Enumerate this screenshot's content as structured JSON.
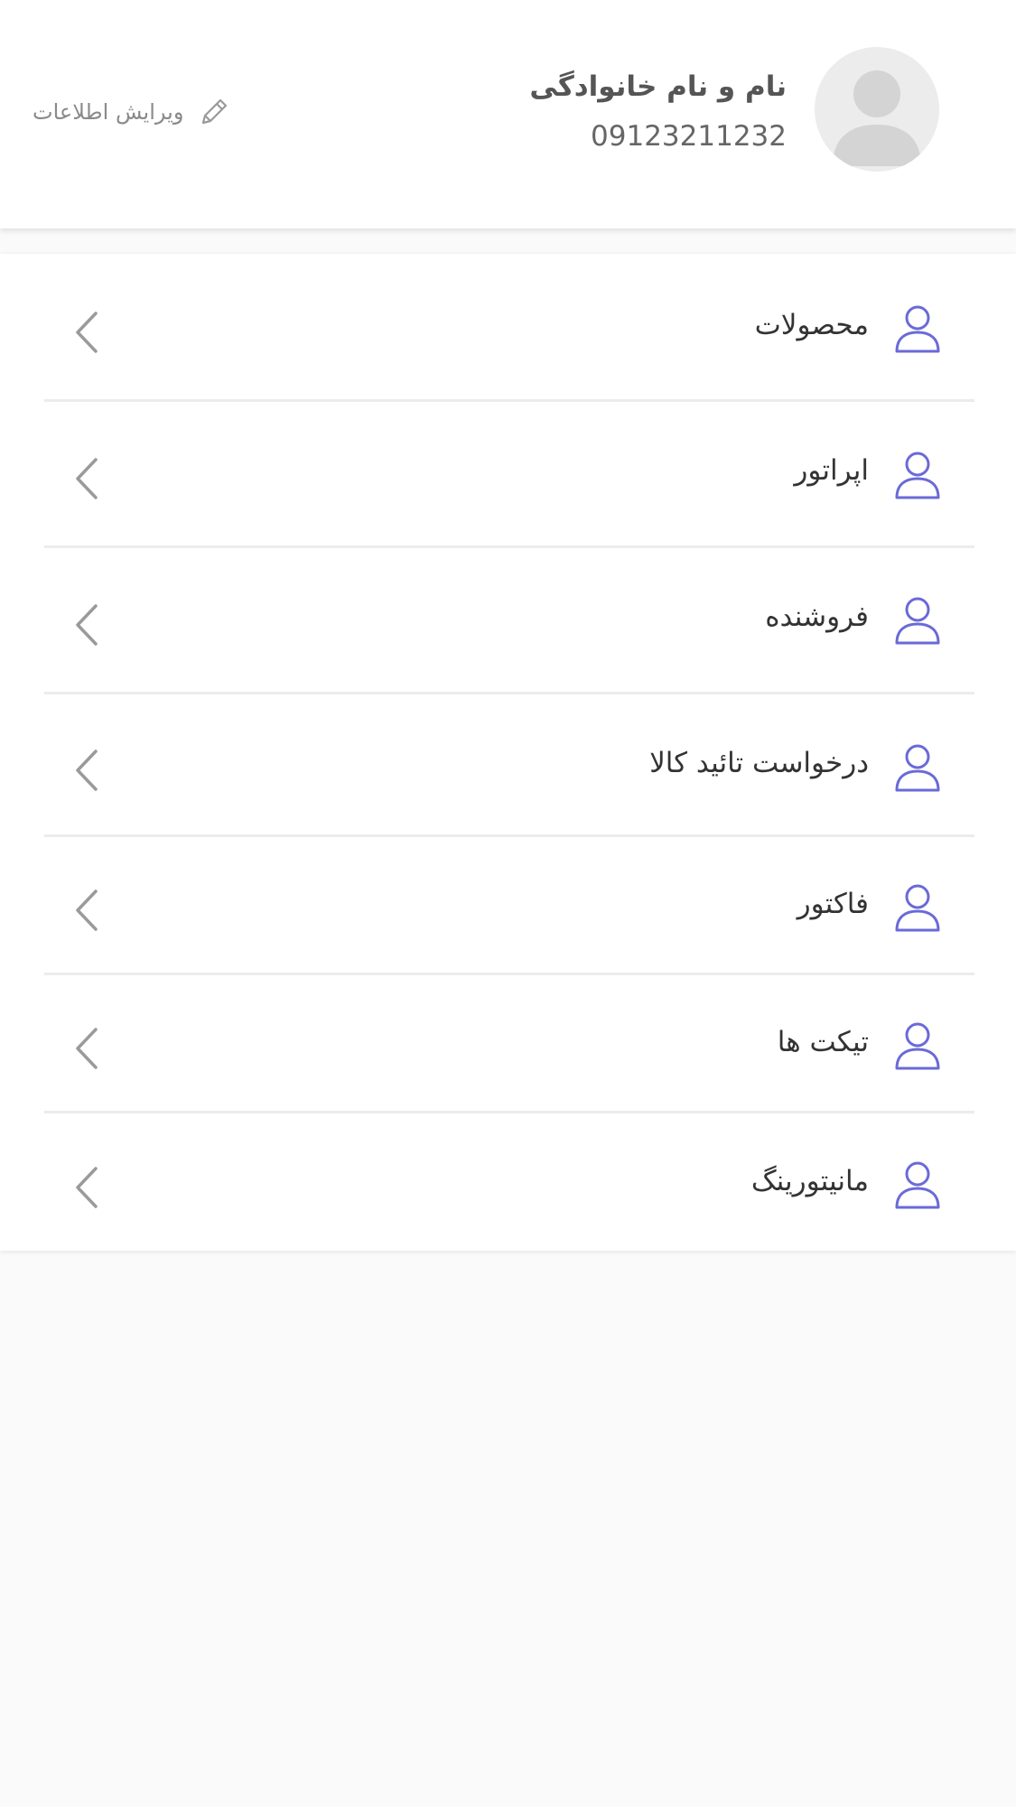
{
  "profile": {
    "name": "نام و نام خانوادگی",
    "phone": "09123211232",
    "edit_label": "ویرایش اطلاعات",
    "avatar_icon": "user-silhouette-icon",
    "edit_icon": "pencil-icon"
  },
  "menu": {
    "item_icon": "user-outline-icon",
    "chevron_icon": "chevron-left-icon",
    "items": [
      {
        "label": "محصولات"
      },
      {
        "label": "اپراتور"
      },
      {
        "label": "فروشنده"
      },
      {
        "label": "درخواست تائید کالا"
      },
      {
        "label": "فاکتور"
      },
      {
        "label": "تیکت ها"
      },
      {
        "label": "مانیتورینگ"
      }
    ]
  },
  "colors": {
    "accent": "#6a6ad8",
    "chevron": "#9a9a9a",
    "background": "#fafafa",
    "card": "#ffffff"
  }
}
